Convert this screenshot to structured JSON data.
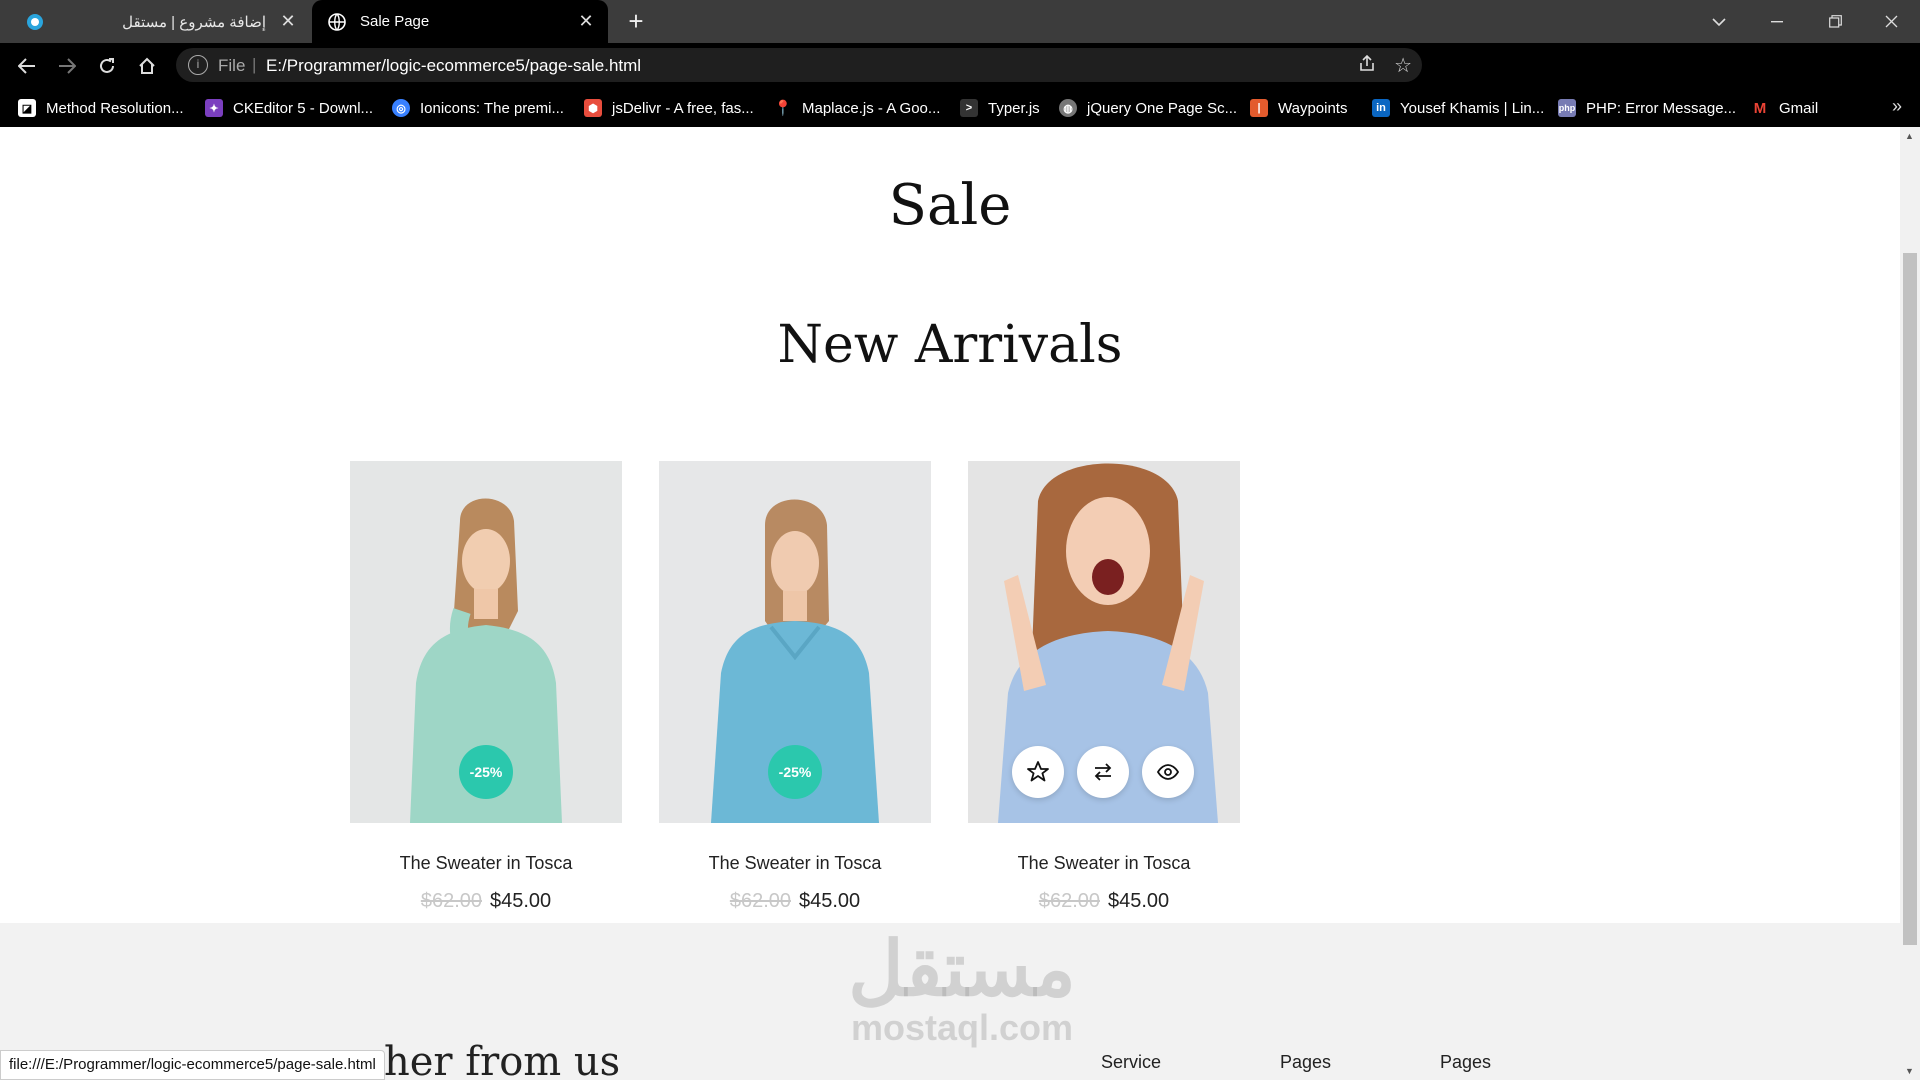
{
  "browser": {
    "tabs": [
      {
        "title": "إضافة مشروع | مستقل",
        "active": false,
        "favicon": "mostaql-icon"
      },
      {
        "title": "Sale Page",
        "active": true,
        "favicon": "globe-icon"
      }
    ],
    "address": {
      "scheme_label": "File",
      "url": "E:/Programmer/logic-ecommerce5/page-sale.html"
    },
    "bookmarks": [
      {
        "label": "Method Resolution...",
        "icon": "method-icon",
        "color": "#ffffff"
      },
      {
        "label": "CKEditor 5 - Downl...",
        "icon": "ckeditor-icon",
        "color": "#7b3fbf"
      },
      {
        "label": "Ionicons: The premi...",
        "icon": "ionicons-icon",
        "color": "#3880ff"
      },
      {
        "label": "jsDelivr - A free, fas...",
        "icon": "jsdelivr-icon",
        "color": "#e84d3d"
      },
      {
        "label": "Maplace.js - A Goo...",
        "icon": "map-pin-icon",
        "color": "#e4573d"
      },
      {
        "label": "Typer.js",
        "icon": "terminal-icon",
        "color": "#333333"
      },
      {
        "label": "jQuery One Page Sc...",
        "icon": "globe-icon",
        "color": "#777777"
      },
      {
        "label": "Waypoints",
        "icon": "waypoints-icon",
        "color": "#e35b2d"
      },
      {
        "label": "Yousef Khamis | Lin...",
        "icon": "linkedin-icon",
        "color": "#0a66c2"
      },
      {
        "label": "PHP: Error Message...",
        "icon": "php-icon",
        "color": "#777bb3"
      },
      {
        "label": "Gmail",
        "icon": "gmail-icon",
        "color": "#ea4335"
      }
    ],
    "status_text": "file:///E:/Programmer/logic-ecommerce5/page-sale.html"
  },
  "page": {
    "sale_title": "Sale",
    "section_title": "New Arrivals",
    "accent_color": "#2bc8ad",
    "products": [
      {
        "name": "The Sweater in Tosca",
        "old_price": "$62.00",
        "price": "$45.00",
        "badge": "-25%",
        "image": "woman-mint-sweater"
      },
      {
        "name": "The Sweater in Tosca",
        "old_price": "$62.00",
        "price": "$45.00",
        "badge": "-25%",
        "image": "woman-blue-sweater"
      },
      {
        "name": "The Sweater in Tosca",
        "old_price": "$62.00",
        "price": "$45.00",
        "image": "excited-woman-denim-shirt",
        "actions": [
          "star-icon",
          "compare-icon",
          "eye-icon"
        ]
      }
    ],
    "footer": {
      "partial_heading": "her from us",
      "columns": [
        "Service",
        "Pages",
        "Pages"
      ]
    },
    "watermark": {
      "arabic": "مستقل",
      "latin": "mostaql.com"
    }
  }
}
